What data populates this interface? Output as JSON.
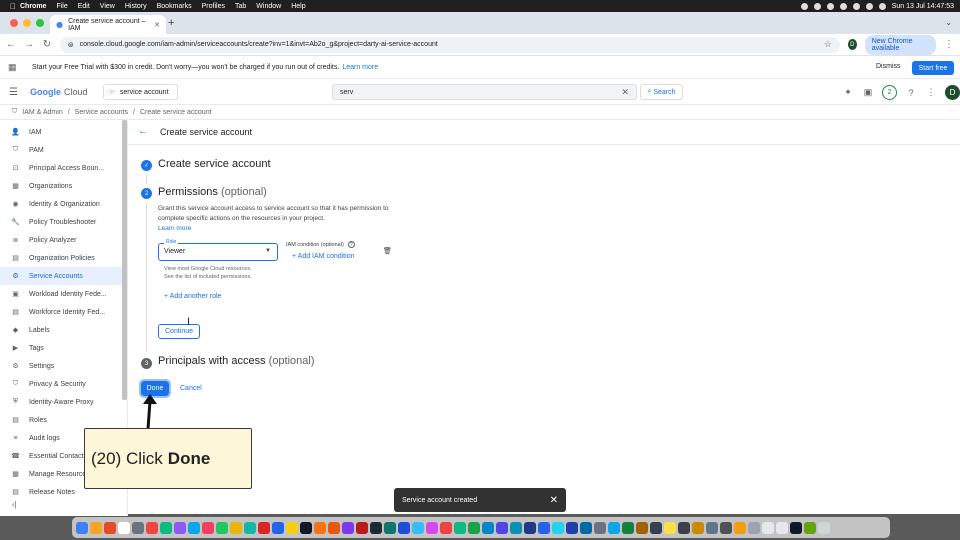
{
  "menubar": {
    "app": "Chrome",
    "items": [
      "File",
      "Edit",
      "View",
      "History",
      "Bookmarks",
      "Profiles",
      "Tab",
      "Window",
      "Help"
    ],
    "clock": "Sun 13 Jul  14:47:53"
  },
  "browser": {
    "tab_title": "Create service account – IAM",
    "url": "console.cloud.google.com/iam-admin/serviceaccounts/create?inv=1&invt=Ab2o_g&project=darty-ai-service-account",
    "profile_initial": "D",
    "new_chrome_label": "New Chrome available"
  },
  "banner": {
    "text": "Start your Free Trial with $300 in credit. Don't worry—you won't be charged if you run out of credits.",
    "link": "Learn more",
    "dismiss": "Dismiss",
    "start_free": "Start free"
  },
  "header": {
    "logo_google": "Google",
    "logo_cloud": "Cloud",
    "project": "service account",
    "search_value": "serv",
    "search_button": "Search",
    "notifications": "2",
    "avatar": "D"
  },
  "breadcrumb": {
    "items": [
      "IAM & Admin",
      "Service accounts",
      "Create service account"
    ]
  },
  "sidebar": {
    "items": [
      {
        "label": "IAM",
        "icon": "person-add-icon"
      },
      {
        "label": "PAM",
        "icon": "shield-icon"
      },
      {
        "label": "Principal Access Boun...",
        "icon": "boundary-icon"
      },
      {
        "label": "Organizations",
        "icon": "grid-icon"
      },
      {
        "label": "Identity & Organization",
        "icon": "account-circle-icon"
      },
      {
        "label": "Policy Troubleshooter",
        "icon": "wrench-icon"
      },
      {
        "label": "Policy Analyzer",
        "icon": "list-search-icon"
      },
      {
        "label": "Organization Policies",
        "icon": "document-icon"
      },
      {
        "label": "Service Accounts",
        "icon": "service-account-icon"
      },
      {
        "label": "Workload Identity Fede...",
        "icon": "workload-icon"
      },
      {
        "label": "Workforce Identity Fed...",
        "icon": "workforce-icon"
      },
      {
        "label": "Labels",
        "icon": "label-icon"
      },
      {
        "label": "Tags",
        "icon": "tag-icon"
      },
      {
        "label": "Settings",
        "icon": "gear-icon"
      },
      {
        "label": "Privacy & Security",
        "icon": "shield-check-icon"
      },
      {
        "label": "Identity-Aware Proxy",
        "icon": "proxy-icon"
      },
      {
        "label": "Roles",
        "icon": "roles-icon"
      },
      {
        "label": "Audit logs",
        "icon": "list-icon"
      },
      {
        "label": "Essential Contacts",
        "icon": "contacts-icon"
      },
      {
        "label": "Manage Resources",
        "icon": "folder-icon"
      },
      {
        "label": "Release Notes",
        "icon": "notes-icon"
      }
    ],
    "active_index": 8
  },
  "main": {
    "page_title": "Create service account",
    "step1_title": "Create service account",
    "step2_num": "2",
    "step2_title": "Permissions",
    "step2_optional": "(optional)",
    "step2_desc": "Grant this service account access to service account so that it has permission to complete specific actions on the resources in your project.",
    "step2_learn_more": "Learn more",
    "role_label": "Role",
    "role_value": "Viewer",
    "role_hint_1": "View most Google Cloud resources.",
    "role_hint_2": "See the list of included permissions.",
    "iam_condition_label": "IAM condition (optional)",
    "add_condition": "Add IAM condition",
    "add_role": "Add another role",
    "continue": "Continue",
    "step3_num": "3",
    "step3_title": "Principals with access",
    "step3_optional": "(optional)",
    "done": "Done",
    "cancel": "Cancel"
  },
  "annotation": {
    "step": "(20) Click",
    "target": "Done"
  },
  "toast": {
    "message": "Service account created"
  },
  "dock": {
    "colors": [
      "#3b82f6",
      "#f5a623",
      "#e34c26",
      "#ffffff",
      "#6b7280",
      "#ef4444",
      "#10b981",
      "#8b5cf6",
      "#0ea5e9",
      "#f43f5e",
      "#22c55e",
      "#eab308",
      "#14b8a6",
      "#dc2626",
      "#2563eb",
      "#facc15",
      "#111827",
      "#f97316",
      "#ea580c",
      "#7c3aed",
      "#b91c1c",
      "#1f2937",
      "#0f766e",
      "#1d4ed8",
      "#38bdf8",
      "#d946ef",
      "#ef4444",
      "#10b981",
      "#16a34a",
      "#0284c7",
      "#4f46e5",
      "#0891b2",
      "#1e3a8a",
      "#2563eb",
      "#22d3ee",
      "#1e40af",
      "#0369a1",
      "#6b7280",
      "#0ea5e9",
      "#15803d",
      "#a16207",
      "#374151",
      "#fde047",
      "#3f3f46",
      "#ca8a04",
      "#64748b",
      "#525252",
      "#f59e0b",
      "#9ca3af",
      "#e5e7eb",
      "#e5e7eb",
      "#0f172a",
      "#65a30d",
      "#d1d5db"
    ]
  }
}
